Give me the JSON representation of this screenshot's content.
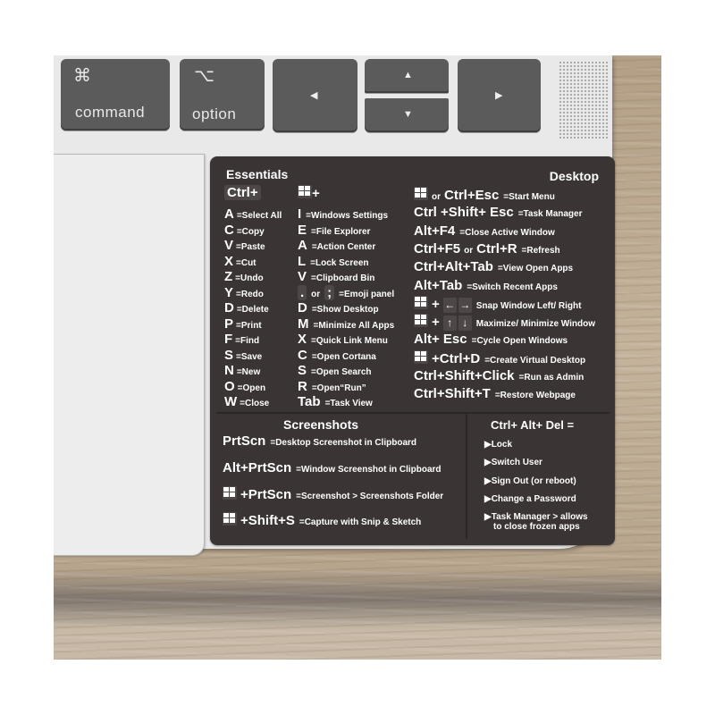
{
  "keyboard": {
    "keys": [
      {
        "name": "command",
        "symbol": "⌘",
        "label": "command"
      },
      {
        "name": "option",
        "symbol": "⌥",
        "label": "option"
      }
    ],
    "arrows": {
      "left": "◀",
      "up": "▲",
      "down": "▼",
      "right": "▶"
    }
  },
  "sticker": {
    "essentials": {
      "title": "Essentials",
      "ctrl_header": "Ctrl+",
      "win_header": "+",
      "ctrl_items": [
        {
          "key": "A",
          "desc": "=Select All"
        },
        {
          "key": "C",
          "desc": "=Copy"
        },
        {
          "key": "V",
          "desc": "=Paste"
        },
        {
          "key": "X",
          "desc": "=Cut"
        },
        {
          "key": "Z",
          "desc": "=Undo"
        },
        {
          "key": "Y",
          "desc": "=Redo"
        },
        {
          "key": "D",
          "desc": "=Delete"
        },
        {
          "key": "P",
          "desc": "=Print"
        },
        {
          "key": "F",
          "desc": "=Find"
        },
        {
          "key": "S",
          "desc": "=Save"
        },
        {
          "key": "N",
          "desc": "=New"
        },
        {
          "key": "O",
          "desc": "=Open"
        },
        {
          "key": "W",
          "desc": "=Close"
        }
      ],
      "win_items": [
        {
          "key": "I",
          "desc": "=Windows Settings"
        },
        {
          "key": "E",
          "desc": "=File Explorer"
        },
        {
          "key": "A",
          "desc": "=Action Center"
        },
        {
          "key": "L",
          "desc": "=Lock Screen"
        },
        {
          "key": "V",
          "desc": "=Clipboard Bin"
        },
        {
          "key": ". or ;",
          "desc": "=Emoji panel"
        },
        {
          "key": "D",
          "desc": "=Show Desktop"
        },
        {
          "key": "M",
          "desc": "=Minimize All Apps"
        },
        {
          "key": "X",
          "desc": "=Quick Link Menu"
        },
        {
          "key": "C",
          "desc": "=Open Cortana"
        },
        {
          "key": "S",
          "desc": "=Open Search"
        },
        {
          "key": "R",
          "desc": "=Open“Run”"
        },
        {
          "key": "Tab",
          "desc": "=Task View"
        }
      ],
      "emoji_dot": ".",
      "emoji_or": "or",
      "emoji_semi": ";"
    },
    "desktop": {
      "title": "Desktop",
      "items": [
        {
          "win": true,
          "key": "or Ctrl+Esc",
          "desc": "=Start Menu"
        },
        {
          "win": false,
          "key": "Ctrl +Shift+ Esc",
          "desc": "=Task Manager"
        },
        {
          "win": false,
          "key": "Alt+F4",
          "desc": "=Close Active Window"
        },
        {
          "win": false,
          "key": "Ctrl+F5 or Ctrl+R",
          "desc": "=Refresh"
        },
        {
          "win": false,
          "key": "Ctrl+Alt+Tab",
          "desc": "=View Open Apps"
        },
        {
          "win": false,
          "key": "Alt+Tab",
          "desc": "=Switch Recent Apps"
        },
        {
          "win": true,
          "key": "+ ← →",
          "desc": "Snap Window Left/ Right"
        },
        {
          "win": true,
          "key": "+ ↑ ↓",
          "desc": "Maximize/ Minimize Window"
        },
        {
          "win": false,
          "key": "Alt+ Esc",
          "desc": "=Cycle Open Windows"
        },
        {
          "win": true,
          "key": "+Ctrl+D",
          "desc": "=Create Virtual Desktop"
        },
        {
          "win": false,
          "key": "Ctrl+Shift+Click",
          "desc": "=Run as Admin"
        },
        {
          "win": false,
          "key": "Ctrl+Shift+T",
          "desc": "=Restore Webpage"
        }
      ],
      "start_or": "or",
      "start_key": "Ctrl+Esc",
      "refresh_key1": "Ctrl+F5",
      "refresh_or": "or",
      "refresh_key2": "Ctrl+R",
      "plus": "+",
      "arrow_left": "←",
      "arrow_right": "→",
      "arrow_up": "↑",
      "arrow_down": "↓"
    },
    "screenshots": {
      "title": "Screenshots",
      "items": [
        {
          "win": false,
          "key": "PrtScn",
          "desc": "=Desktop Screenshot in Clipboard"
        },
        {
          "win": false,
          "key": "Alt+PrtScn",
          "desc": "=Window Screenshot in Clipboard"
        },
        {
          "win": true,
          "key": "+PrtScn",
          "desc": "=Screenshot > Screenshots Folder"
        },
        {
          "win": true,
          "key": "+Shift+S",
          "desc": "=Capture with Snip & Sketch"
        }
      ]
    },
    "ctrl_alt_del": {
      "title": "Ctrl+ Alt+ Del =",
      "bullet": "▶",
      "items": [
        "Lock",
        "Switch User",
        "Sign Out (or reboot)",
        "Change a Password",
        "Task Manager > allows"
      ],
      "last_item_cont": "to close frozen apps"
    }
  }
}
